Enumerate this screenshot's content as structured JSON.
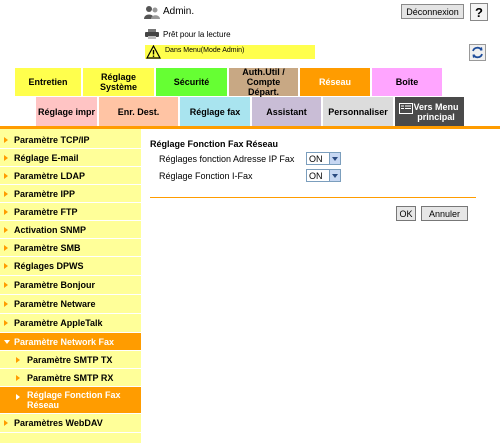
{
  "header": {
    "user_label": "Admin.",
    "logout_label": "Déconnexion",
    "help_label": "?",
    "status_text": "Prêt pour la lecture",
    "alert_text": "Dans Menu(Mode Admin)"
  },
  "tabs": [
    {
      "label": "Entretien",
      "color": "#ffff4d",
      "active": false
    },
    {
      "label": "Réglage Système",
      "color": "#ffff4d",
      "active": false
    },
    {
      "label": "Sécurité",
      "color": "#66ff33",
      "active": false
    },
    {
      "label": "Auth.Util / Compte Départ.",
      "color": "#c8a884",
      "active": false
    },
    {
      "label": "Réseau",
      "color": "#ff9c00",
      "active": true
    },
    {
      "label": "Boîte",
      "color": "#ffa5ff",
      "active": false
    }
  ],
  "subtabs": [
    {
      "label": "Réglage impr",
      "color": "#ffc4c4"
    },
    {
      "label": "Enr. Dest.",
      "color": "#ffc4a4"
    },
    {
      "label": "Réglage fax",
      "color": "#a9e4ef"
    },
    {
      "label": "Assistant",
      "color": "#c9bdd6"
    },
    {
      "label": "Personnaliser",
      "color": "#dcdcdc"
    },
    {
      "label": "Vers Menu principal",
      "color": "#4a4a4a"
    }
  ],
  "sidebar": {
    "items": [
      {
        "label": "Paramètre TCP/IP"
      },
      {
        "label": "Réglage E-mail"
      },
      {
        "label": "Paramètre LDAP"
      },
      {
        "label": "Paramètre IPP"
      },
      {
        "label": "Paramètre FTP"
      },
      {
        "label": "Activation SNMP"
      },
      {
        "label": "Paramètre SMB"
      },
      {
        "label": "Réglages DPWS"
      },
      {
        "label": "Paramètre Bonjour"
      },
      {
        "label": "Paramètre Netware"
      },
      {
        "label": "Paramètre AppleTalk"
      },
      {
        "label": "Paramètre Network Fax"
      },
      {
        "label": "Paramètre SMTP TX"
      },
      {
        "label": "Paramètre SMTP RX"
      },
      {
        "label": "Réglage Fonction Fax Réseau"
      },
      {
        "label": "Paramètres WebDAV"
      }
    ]
  },
  "main": {
    "title": "Réglage Fonction Fax Réseau",
    "rows": [
      {
        "label": "Réglages fonction Adresse IP Fax",
        "value": "ON"
      },
      {
        "label": "Réglage Fonction I-Fax",
        "value": "ON"
      }
    ],
    "ok_label": "OK",
    "cancel_label": "Annuler"
  }
}
